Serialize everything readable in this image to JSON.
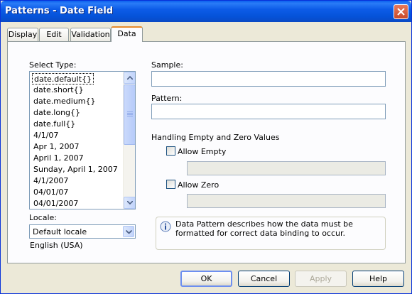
{
  "window": {
    "title": "Patterns - Date Field"
  },
  "tabs": [
    {
      "label": "Display"
    },
    {
      "label": "Edit"
    },
    {
      "label": "Validation"
    },
    {
      "label": "Data"
    }
  ],
  "select_type": {
    "label": "Select Type:",
    "items": [
      "date.default{}",
      "date.short{}",
      "date.medium{}",
      "date.long{}",
      "date.full{}",
      "4/1/07",
      "Apr 1, 2007",
      "April 1, 2007",
      "Sunday, April 1, 2007",
      "4/1/2007",
      "04/01/07",
      "04/01/2007"
    ],
    "selected_index": 0
  },
  "locale": {
    "label": "Locale:",
    "value": "Default locale",
    "note": "English (USA)"
  },
  "sample": {
    "label": "Sample:",
    "value": ""
  },
  "pattern": {
    "label": "Pattern:",
    "value": ""
  },
  "handling": {
    "heading": "Handling Empty and Zero Values",
    "allow_empty": {
      "label": "Allow Empty",
      "checked": false,
      "value": ""
    },
    "allow_zero": {
      "label": "Allow Zero",
      "checked": false,
      "value": ""
    }
  },
  "info": {
    "icon": "info-icon",
    "text": "Data Pattern describes how the data must be formatted for correct data binding to occur."
  },
  "buttons": {
    "ok": "OK",
    "cancel": "Cancel",
    "apply": "Apply",
    "help": "Help"
  },
  "colors": {
    "title_bar": "#0a5fef",
    "active_tab_accent": "#e68b2c",
    "dialog_bg": "#ece9d8"
  }
}
